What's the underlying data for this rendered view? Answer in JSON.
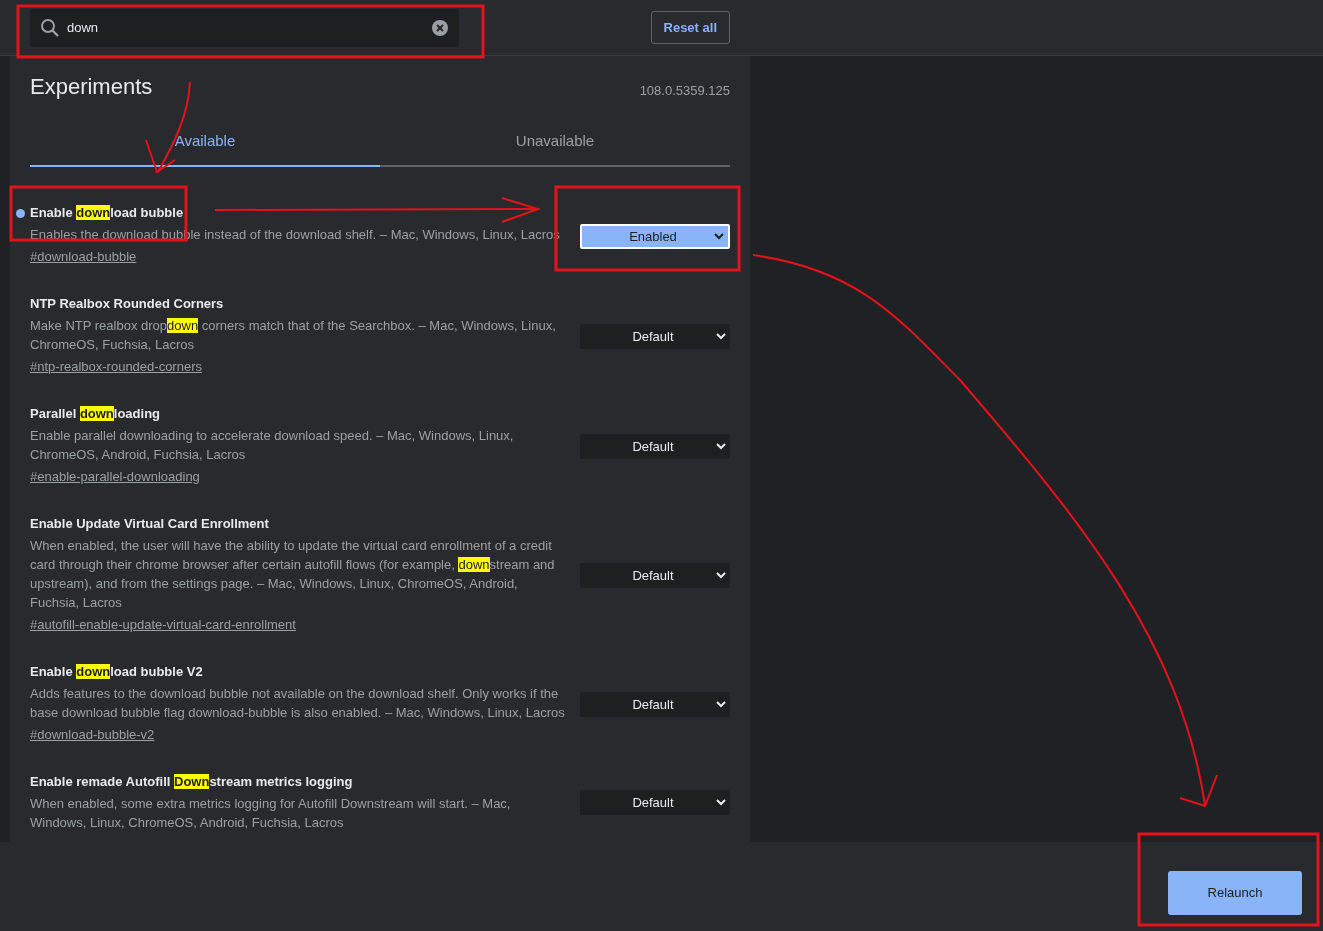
{
  "search": {
    "value": "down"
  },
  "reset_button": "Reset all",
  "title": "Experiments",
  "version": "108.0.5359.125",
  "tabs": [
    {
      "label": "Available",
      "selected": true
    },
    {
      "label": "Unavailable",
      "selected": false
    }
  ],
  "flags": [
    {
      "title": [
        {
          "text": "Enable "
        },
        {
          "text": "down",
          "highlighted": true
        },
        {
          "text": "load bubble"
        }
      ],
      "modified": true,
      "description": [
        {
          "text": "Enables the download bubble instead of the download shelf. – Mac, Windows, Linux, Lacros"
        }
      ],
      "link": "#download-bubble",
      "value": "Enabled"
    },
    {
      "title": [
        {
          "text": "NTP Realbox Rounded Corners"
        }
      ],
      "modified": false,
      "description": [
        {
          "text": "Make NTP realbox drop"
        },
        {
          "text": "down",
          "highlighted": true
        },
        {
          "text": " corners match that of the Searchbox. – Mac, Windows, Linux, ChromeOS, Fuchsia, Lacros"
        }
      ],
      "link": "#ntp-realbox-rounded-corners",
      "value": "Default"
    },
    {
      "title": [
        {
          "text": "Parallel "
        },
        {
          "text": "down",
          "highlighted": true
        },
        {
          "text": "loading"
        }
      ],
      "modified": false,
      "description": [
        {
          "text": "Enable parallel downloading to accelerate download speed. – Mac, Windows, Linux, ChromeOS, Android, Fuchsia, Lacros"
        }
      ],
      "link": "#enable-parallel-downloading",
      "value": "Default"
    },
    {
      "title": [
        {
          "text": "Enable Update Virtual Card Enrollment"
        }
      ],
      "modified": false,
      "description": [
        {
          "text": "When enabled, the user will have the ability to update the virtual card enrollment of a credit card through their chrome browser after certain autofill flows (for example, "
        },
        {
          "text": "down",
          "highlighted": true
        },
        {
          "text": "stream and upstream), and from the settings page. – Mac, Windows, Linux, ChromeOS, Android, Fuchsia, Lacros"
        }
      ],
      "link": "#autofill-enable-update-virtual-card-enrollment",
      "value": "Default"
    },
    {
      "title": [
        {
          "text": "Enable "
        },
        {
          "text": "down",
          "highlighted": true
        },
        {
          "text": "load bubble V2"
        }
      ],
      "modified": false,
      "description": [
        {
          "text": "Adds features to the download bubble not available on the download shelf. Only works if the base download bubble flag download-bubble is also enabled. – Mac, Windows, Linux, Lacros"
        }
      ],
      "link": "#download-bubble-v2",
      "value": "Default"
    },
    {
      "title": [
        {
          "text": "Enable remade Autofill "
        },
        {
          "text": "Down",
          "highlighted": true
        },
        {
          "text": "stream metrics logging"
        }
      ],
      "modified": false,
      "description": [
        {
          "text": "When enabled, some extra metrics logging for Autofill Downstream will start. – Mac, Windows, Linux, ChromeOS, Android, Fuchsia, Lacros"
        }
      ],
      "value": "Default"
    }
  ],
  "relaunch_button": "Relaunch"
}
